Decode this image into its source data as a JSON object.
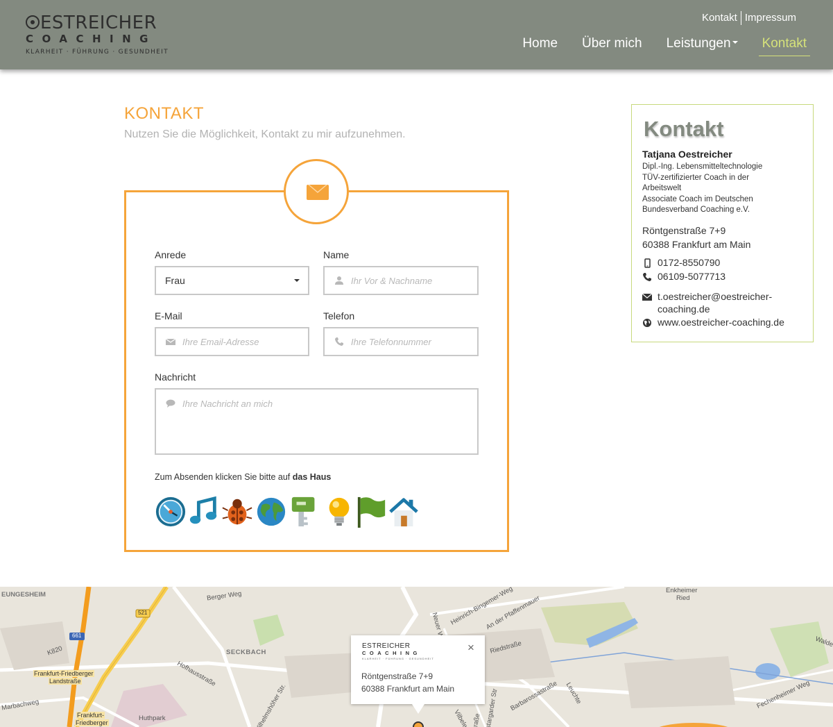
{
  "header": {
    "logo": {
      "line1": "ESTREICHER",
      "line2": "COACHING",
      "line3": "KLARHEIT · FÜHRUNG · GESUNDHEIT"
    },
    "meta_links": [
      "Kontakt",
      "Impressum"
    ],
    "nav": [
      {
        "label": "Home",
        "active": false
      },
      {
        "label": "Über mich",
        "active": false
      },
      {
        "label": "Leistungen",
        "active": false,
        "dropdown": true
      },
      {
        "label": "Kontakt",
        "active": true
      }
    ],
    "bg_color": "#838a80",
    "active_color": "#d6e27a"
  },
  "main": {
    "title": "KONTAKT",
    "subtitle": "Nutzen Sie die Möglichkeit, Kontakt zu mir aufzunehmen.",
    "accent_color": "#f5a43a",
    "form": {
      "anrede": {
        "label": "Anrede",
        "value": "Frau"
      },
      "name": {
        "label": "Name",
        "placeholder": "Ihr Vor & Nachname"
      },
      "email": {
        "label": "E-Mail",
        "placeholder": "Ihre Email-Adresse"
      },
      "telefon": {
        "label": "Telefon",
        "placeholder": "Ihre Telefonnummer"
      },
      "nachricht": {
        "label": "Nachricht",
        "placeholder": "Ihre Nachricht an mich"
      },
      "hint_prefix": "Zum Absenden klicken Sie bitte auf",
      "hint_bold": "das Haus",
      "captcha_icons": [
        "compass-icon",
        "music-note-icon",
        "bug-icon",
        "globe-icon",
        "key-icon",
        "lightbulb-icon",
        "flag-icon",
        "house-icon"
      ]
    }
  },
  "sidebar": {
    "title": "Kontakt",
    "name": "Tatjana Oestreicher",
    "desc_lines": [
      "Dipl.-Ing. Lebensmitteltechnologie",
      "TÜV-zertifizierter Coach in der",
      "Arbeitswelt",
      "Associate Coach im Deutschen",
      "Bundesverband Coaching e.V."
    ],
    "address_lines": [
      "Röntgenstraße 7+9",
      "60388 Frankfurt am Main"
    ],
    "mobile": "0172-8550790",
    "phone": "06109-5077713",
    "email_line1": "t.oestreicher@oestreicher-",
    "email_line2": "coaching.de",
    "website": "www.oestreicher-coaching.de"
  },
  "map": {
    "labels": [
      "EUNGESHEIM",
      "Berger Weg",
      "521",
      "661",
      "K820",
      "Frankfurt-Friedberger",
      "Landstraße",
      "SECKBACH",
      "Hofhausstraße",
      "Marbachweg",
      "Huthpark",
      "Frankfurt-",
      "Friedberger",
      "Wilhelmshöher Str.",
      "Neuer W",
      "Heinrich-Bingemer-Weg",
      "An der Pfaffenmauer",
      "Riedstraße",
      "Enkheimer",
      "Ried",
      "Walde",
      "Barbarossastraße",
      "Leuchte",
      "Fechenheimer Weg",
      "Vilbele",
      "stargarder Str",
      "traße"
    ],
    "popup": {
      "logo_line1": "ESTREICHER",
      "logo_line2": "COACHING",
      "logo_line3": "KLARHEIT · FÜHRUNG · GESUNDHEIT",
      "close": "×",
      "address_line1": "Röntgenstraße 7+9",
      "address_line2": "60388 Frankfurt am Main"
    }
  }
}
